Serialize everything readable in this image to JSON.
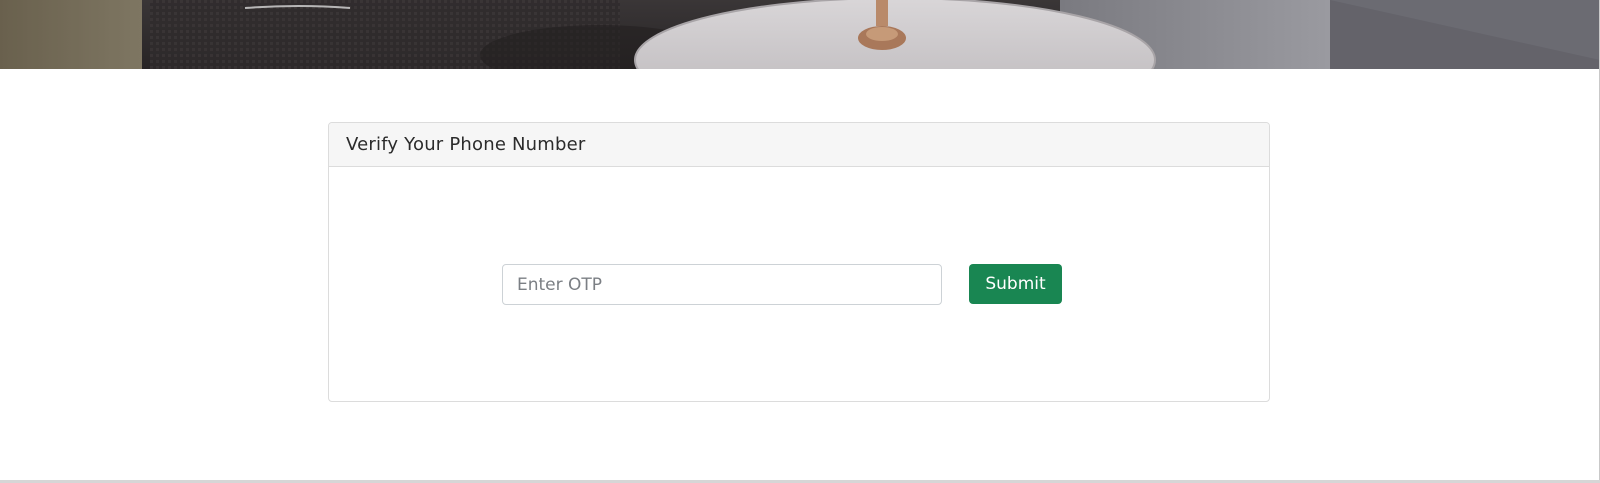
{
  "hero": {
    "image_description": "interior-photo-banner"
  },
  "verify_card": {
    "title": "Verify Your Phone Number",
    "otp_input": {
      "value": "",
      "placeholder": "Enter OTP"
    },
    "submit_label": "Submit"
  },
  "colors": {
    "submit_button": "#198652",
    "card_header_bg": "#f6f6f6",
    "card_border": "#dcdcdc"
  }
}
